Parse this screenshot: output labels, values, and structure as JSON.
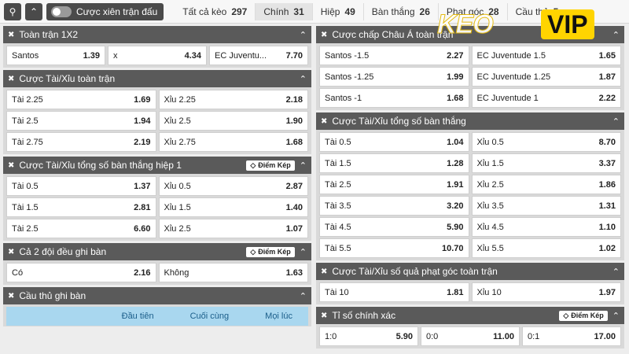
{
  "topbar": {
    "search_icon": "search-icon",
    "collapse_icon": "double-chevron-up-icon",
    "toggle_label": "Cược xiên trận đấu",
    "tabs": [
      {
        "label": "Tất cả kèo",
        "count": "297"
      },
      {
        "label": "Chính",
        "count": "31"
      },
      {
        "label": "Hiệp",
        "count": "49"
      },
      {
        "label": "Bàn thắng",
        "count": "26"
      },
      {
        "label": "Phạt góc",
        "count": "28"
      },
      {
        "label": "Cầu thủ",
        "count": "5"
      }
    ]
  },
  "logo": {
    "part1": "KEO",
    "part2": "VIP"
  },
  "left": {
    "s1": {
      "title": "Toàn trận 1X2",
      "rows": [
        [
          {
            "l": "Santos",
            "o": "1.39"
          },
          {
            "l": "x",
            "o": "4.34"
          },
          {
            "l": "EC Juventu...",
            "o": "7.70"
          }
        ]
      ]
    },
    "s2": {
      "title": "Cược Tài/Xỉu toàn trận",
      "rows": [
        [
          {
            "l": "Tài 2.25",
            "o": "1.69"
          },
          {
            "l": "Xỉu 2.25",
            "o": "2.18"
          }
        ],
        [
          {
            "l": "Tài 2.5",
            "o": "1.94"
          },
          {
            "l": "Xỉu 2.5",
            "o": "1.90"
          }
        ],
        [
          {
            "l": "Tài 2.75",
            "o": "2.19"
          },
          {
            "l": "Xỉu 2.75",
            "o": "1.68"
          }
        ]
      ]
    },
    "s3": {
      "title": "Cược Tài/Xỉu tổng số bàn thắng hiệp 1",
      "badge": "Điểm Kép",
      "rows": [
        [
          {
            "l": "Tài 0.5",
            "o": "1.37"
          },
          {
            "l": "Xỉu 0.5",
            "o": "2.87"
          }
        ],
        [
          {
            "l": "Tài 1.5",
            "o": "2.81"
          },
          {
            "l": "Xỉu 1.5",
            "o": "1.40"
          }
        ],
        [
          {
            "l": "Tài 2.5",
            "o": "6.60"
          },
          {
            "l": "Xỉu 2.5",
            "o": "1.07"
          }
        ]
      ]
    },
    "s4": {
      "title": "Cả 2 đội đều ghi bàn",
      "badge": "Điểm Kép",
      "rows": [
        [
          {
            "l": "Có",
            "o": "2.16"
          },
          {
            "l": "Không",
            "o": "1.63"
          }
        ]
      ]
    },
    "s5": {
      "title": "Cầu thủ ghi bàn",
      "cols": [
        "Đầu tiên",
        "Cuối cùng",
        "Mọi lúc"
      ]
    }
  },
  "right": {
    "s1": {
      "title": "Cược chấp Châu Á toàn trận",
      "rows": [
        [
          {
            "l": "Santos -1.5",
            "o": "2.27"
          },
          {
            "l": "EC Juventude 1.5",
            "o": "1.65"
          }
        ],
        [
          {
            "l": "Santos -1.25",
            "o": "1.99"
          },
          {
            "l": "EC Juventude 1.25",
            "o": "1.87"
          }
        ],
        [
          {
            "l": "Santos -1",
            "o": "1.68"
          },
          {
            "l": "EC Juventude 1",
            "o": "2.22"
          }
        ]
      ]
    },
    "s2": {
      "title": "Cược Tài/Xỉu tổng số bàn thắng",
      "rows": [
        [
          {
            "l": "Tài 0.5",
            "o": "1.04"
          },
          {
            "l": "Xỉu 0.5",
            "o": "8.70"
          }
        ],
        [
          {
            "l": "Tài 1.5",
            "o": "1.28"
          },
          {
            "l": "Xỉu 1.5",
            "o": "3.37"
          }
        ],
        [
          {
            "l": "Tài 2.5",
            "o": "1.91"
          },
          {
            "l": "Xỉu 2.5",
            "o": "1.86"
          }
        ],
        [
          {
            "l": "Tài 3.5",
            "o": "3.20"
          },
          {
            "l": "Xỉu 3.5",
            "o": "1.31"
          }
        ],
        [
          {
            "l": "Tài 4.5",
            "o": "5.90"
          },
          {
            "l": "Xỉu 4.5",
            "o": "1.10"
          }
        ],
        [
          {
            "l": "Tài 5.5",
            "o": "10.70"
          },
          {
            "l": "Xỉu 5.5",
            "o": "1.02"
          }
        ]
      ]
    },
    "s3": {
      "title": "Cược Tài/Xỉu số quả phạt góc toàn trận",
      "rows": [
        [
          {
            "l": "Tài 10",
            "o": "1.81"
          },
          {
            "l": "Xỉu 10",
            "o": "1.97"
          }
        ]
      ]
    },
    "s4": {
      "title": "Tỉ số chính xác",
      "badge": "Điểm Kép",
      "rows": [
        [
          {
            "l": "1:0",
            "o": "5.90"
          },
          {
            "l": "0:0",
            "o": "11.00"
          },
          {
            "l": "0:1",
            "o": "17.00"
          }
        ]
      ]
    }
  }
}
